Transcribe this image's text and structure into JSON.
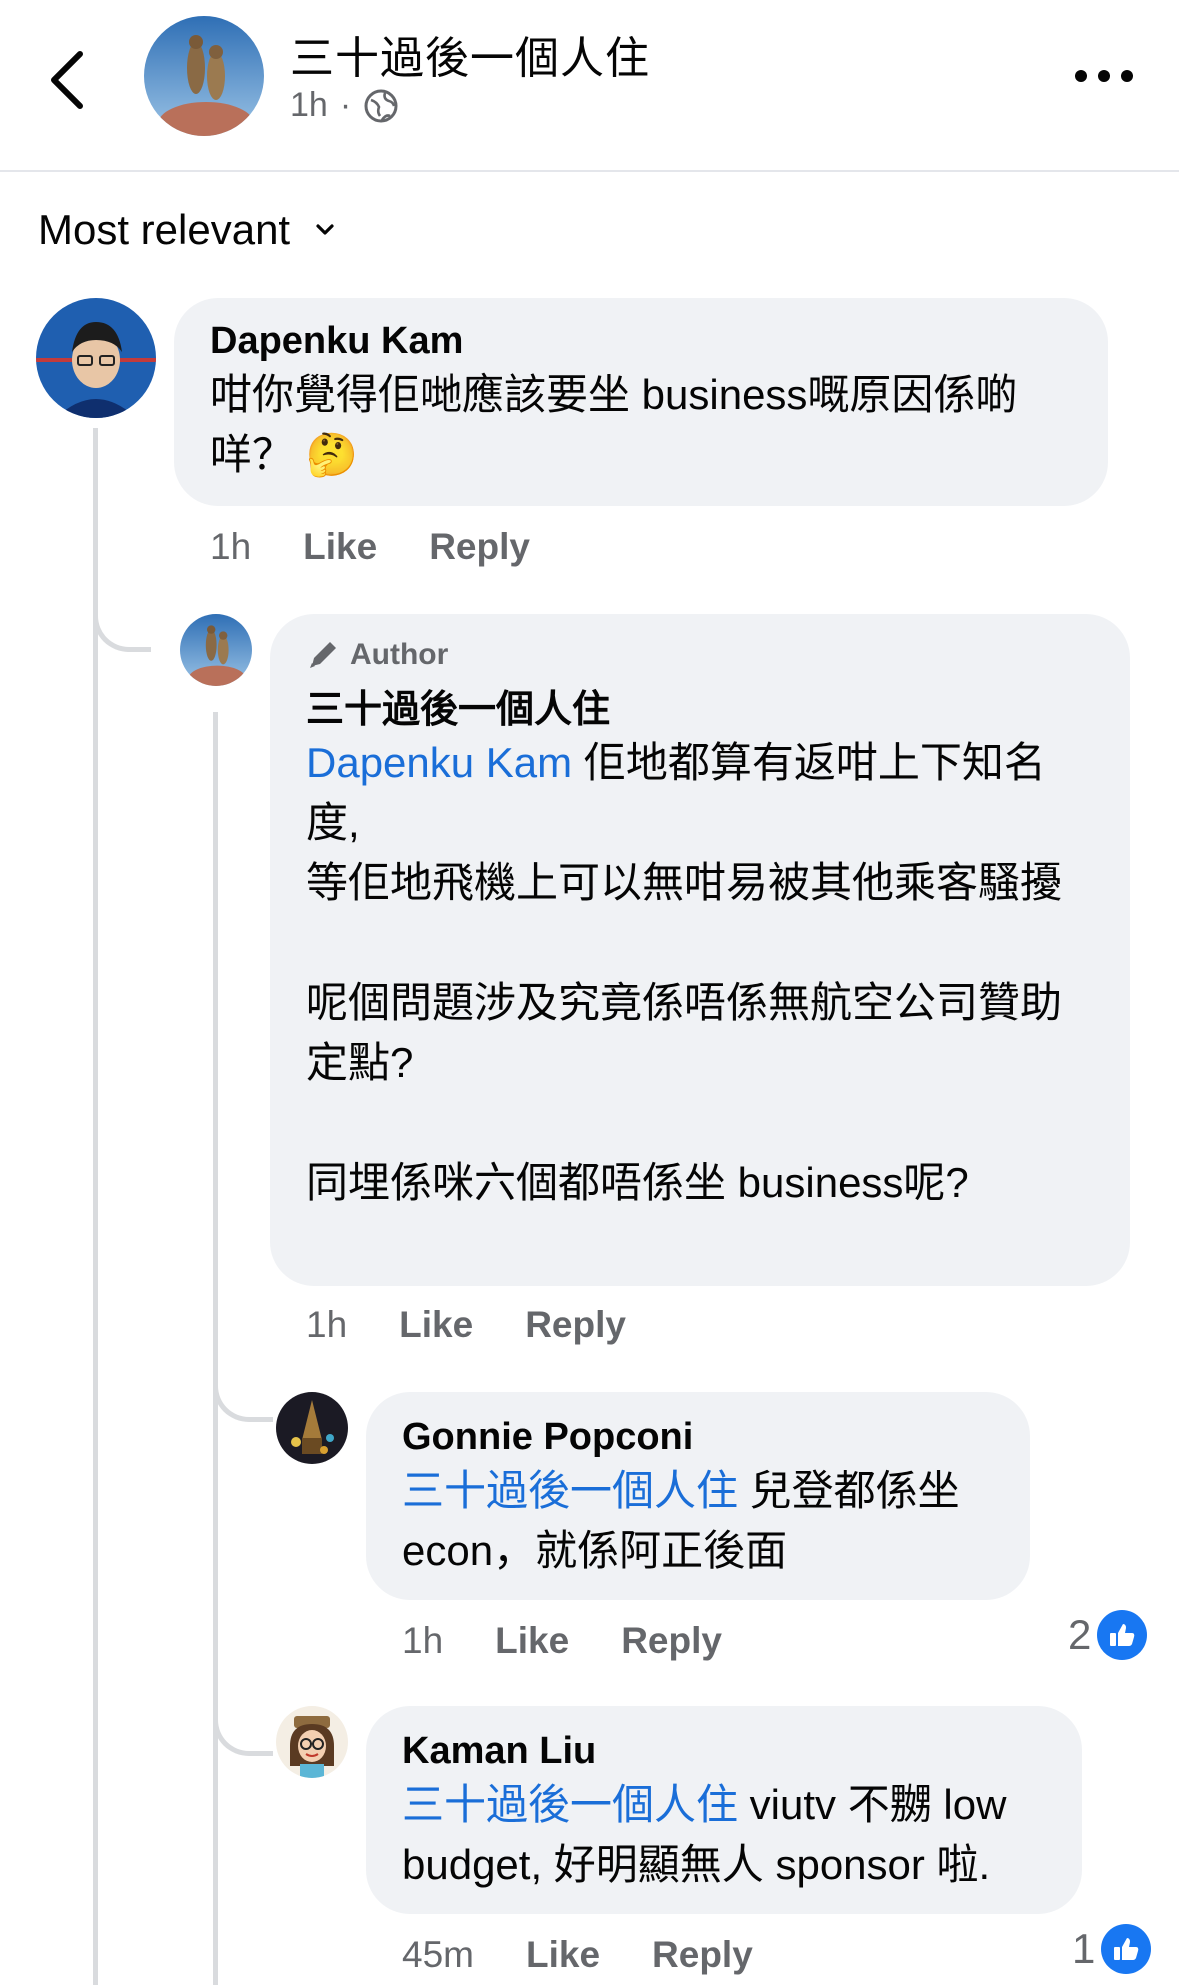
{
  "header": {
    "back_icon": "chevron-left-icon",
    "title": "三十過後一個人住",
    "time": "1h",
    "separator": "·",
    "privacy_icon": "globe-icon",
    "more_icon": "more-horizontal-icon"
  },
  "sort": {
    "label": "Most relevant",
    "icon": "chevron-down-icon"
  },
  "comments": [
    {
      "author": "Dapenku Kam",
      "text": "咁你覺得佢哋應該要坐 business嘅原因係啲\n咩？",
      "emoji": "🤔",
      "time": "1h",
      "like_label": "Like",
      "reply_label": "Reply"
    },
    {
      "badge": "Author",
      "badge_icon": "pen-icon",
      "author": "三十過後一個人住",
      "mention": "Dapenku Kam",
      "text": " 佢地都算有返咁上下知名度,\n等佢地飛機上可以無咁易被其他乘客騷擾\n\n呢個問題涉及究竟係唔係無航空公司贊助定點?\n\n同埋係咪六個都唔係坐 business呢?",
      "time": "1h",
      "like_label": "Like",
      "reply_label": "Reply"
    },
    {
      "author": "Gonnie Popconi",
      "mention": "三十過後一個人住",
      "text": " 兒登都係坐\necon，就係阿正後面",
      "time": "1h",
      "like_label": "Like",
      "reply_label": "Reply",
      "reaction_count": "2",
      "reaction_icon": "like-icon"
    },
    {
      "author": "Kaman Liu",
      "mention": "三十過後一個人住",
      "text": " viutv 不嬲 low\nbudget, 好明顯無人 sponsor 啦.",
      "time": "45m",
      "like_label": "Like",
      "reply_label": "Reply",
      "reaction_count": "1",
      "reaction_icon": "like-icon"
    }
  ],
  "colors": {
    "mention": "#1a6ed8",
    "bubble": "#f0f2f5",
    "like_blue": "#1877f2",
    "secondary_text": "#65676b"
  }
}
